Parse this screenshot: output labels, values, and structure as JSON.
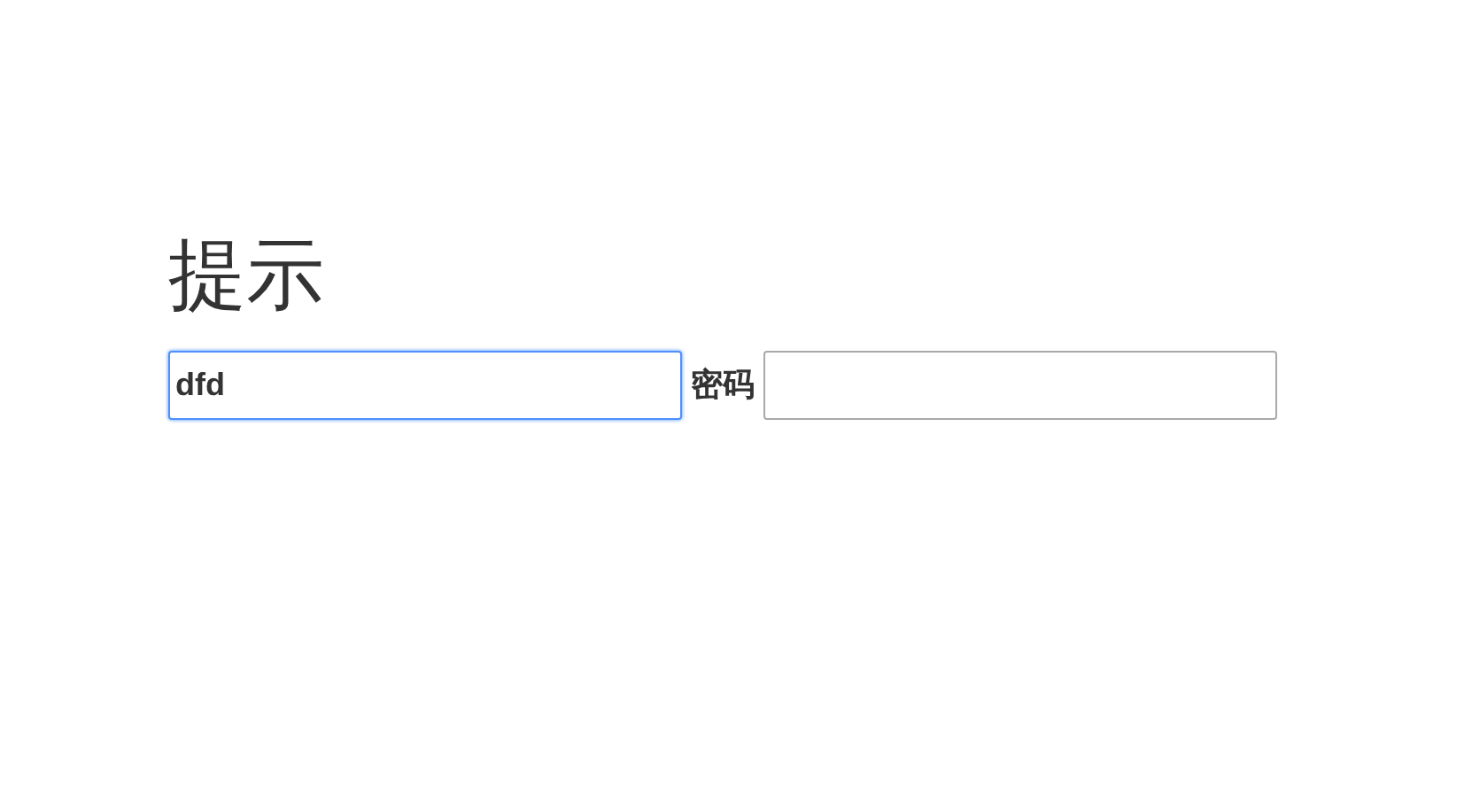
{
  "heading": "提示",
  "username_field": {
    "value": "dfd",
    "focused": true
  },
  "password_label": "密码",
  "password_field": {
    "focused": false
  }
}
